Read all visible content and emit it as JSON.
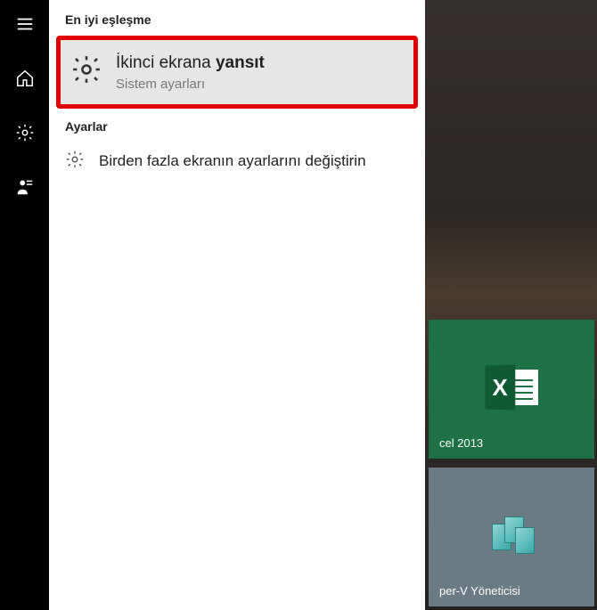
{
  "sidebar": {
    "items": [
      {
        "name": "hamburger"
      },
      {
        "name": "home"
      },
      {
        "name": "settings"
      },
      {
        "name": "user"
      }
    ]
  },
  "search": {
    "best_match_header": "En iyi eşleşme",
    "best_match": {
      "title_prefix": "İkinci ekrana ",
      "title_bold": "yansıt",
      "subtitle": "Sistem ayarları"
    },
    "settings_header": "Ayarlar",
    "settings_items": [
      {
        "label": "Birden fazla ekranın ayarlarını değiştirin"
      }
    ]
  },
  "tiles": {
    "excel": {
      "label": "cel 2013"
    },
    "hyperv": {
      "label": "per-V Yöneticisi"
    }
  }
}
